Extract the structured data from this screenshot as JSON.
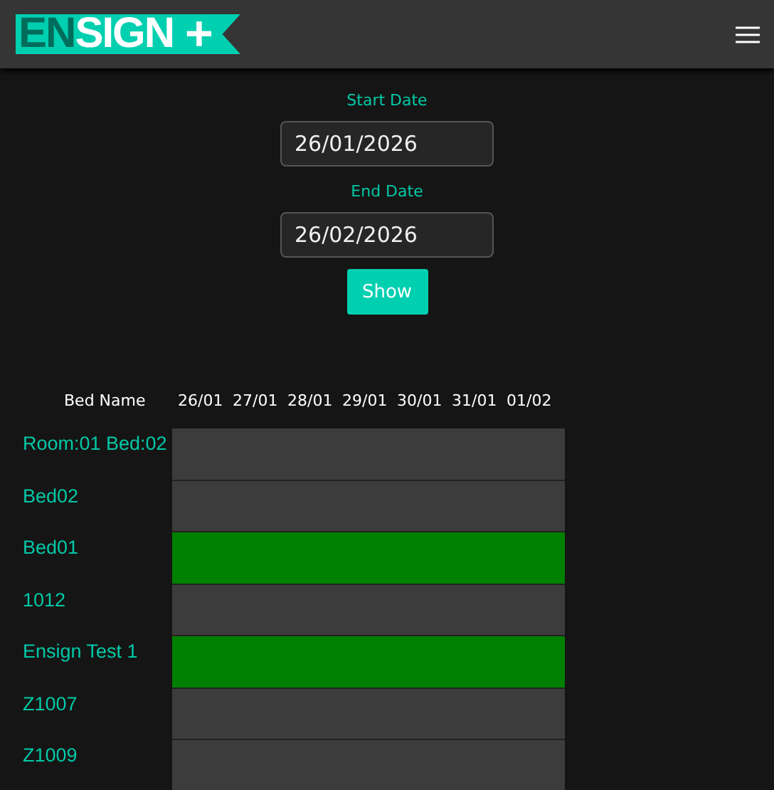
{
  "header": {
    "logo": {
      "first": "EN",
      "rest": "SIGN",
      "mark": "+"
    }
  },
  "form": {
    "start": {
      "label": "Start Date",
      "value": "26/01/2026"
    },
    "end": {
      "label": "End Date",
      "value": "26/02/2026"
    },
    "button": "Show"
  },
  "table": {
    "name_column": "Bed Name",
    "dates": [
      "26/01",
      "27/01",
      "28/01",
      "29/01",
      "30/01",
      "31/01",
      "01/02"
    ],
    "rows": [
      {
        "name": "Room:01 Bed:02",
        "occupied": false
      },
      {
        "name": "Bed02",
        "occupied": false
      },
      {
        "name": "Bed01",
        "occupied": true
      },
      {
        "name": "1012",
        "occupied": false
      },
      {
        "name": "Ensign Test 1",
        "occupied": true
      },
      {
        "name": "Z1007",
        "occupied": false
      },
      {
        "name": "Z1009",
        "occupied": false
      }
    ]
  }
}
